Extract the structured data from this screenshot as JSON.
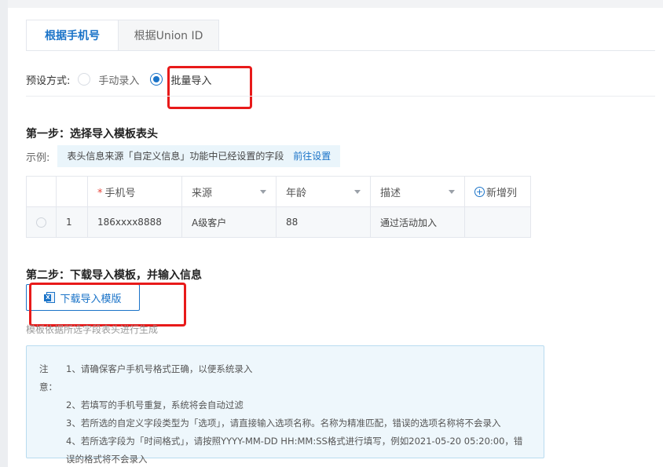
{
  "tabs": [
    {
      "label": "根据手机号",
      "active": true
    },
    {
      "label": "根据Union ID",
      "active": false
    }
  ],
  "preset": {
    "label": "预设方式:",
    "options": [
      {
        "label": "手动录入",
        "checked": false
      },
      {
        "label": "批量导入",
        "checked": true
      }
    ]
  },
  "step1": {
    "title": "第一步：选择导入模板表头",
    "example_label": "示例:",
    "example_text": "表头信息来源「自定义信息」功能中已经设置的字段",
    "example_link": "前往设置"
  },
  "table": {
    "headers": [
      "手机号",
      "来源",
      "年龄",
      "描述"
    ],
    "required_mark": "*",
    "add_column": "新增列",
    "row": {
      "index": "1",
      "cells": [
        "186xxxx8888",
        "A级客户",
        "88",
        "通过活动加入"
      ]
    }
  },
  "step2": {
    "title": "第二步：下载导入模板，并输入信息",
    "download_button": "下载导入模版",
    "hint": "模板依据所选字段表头进行生成"
  },
  "notice": {
    "prefix": "注意：",
    "lines": [
      "1、请确保客户手机号格式正确，以便系统录入",
      "2、若填写的手机号重复，系统将会自动过滤",
      "3、若所选的自定义字段类型为「选项」，请直接输入选项名称。名称为精准匹配，错误的选项名称将不会录入",
      "4、若所选字段为「时间格式」，请按照YYYY-MM-DD HH:MM:SS格式进行填写，例如2021-05-20 05:20:00，错",
      "误的格式将不会录入"
    ]
  },
  "colors": {
    "accent": "#1a73c8",
    "highlight": "#e81a1a",
    "notice_bg": "#eef7fc"
  },
  "icons": {
    "download_button_icon": "excel-icon",
    "add_column_icon": "plus-circle-icon"
  }
}
